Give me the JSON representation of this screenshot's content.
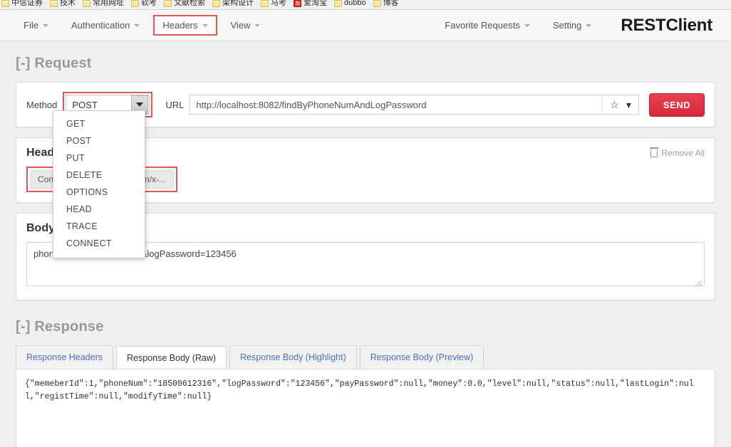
{
  "browser": {
    "bookmarks": [
      {
        "label": "中信证券",
        "icon": "folder-icon",
        "type": "folder"
      },
      {
        "label": "技术",
        "icon": "folder-icon",
        "type": "folder"
      },
      {
        "label": "常用网址",
        "icon": "folder-icon",
        "type": "folder"
      },
      {
        "label": "软考",
        "icon": "folder-icon",
        "type": "folder"
      },
      {
        "label": "文献检索",
        "icon": "folder-icon",
        "type": "folder"
      },
      {
        "label": "架构设计",
        "icon": "folder-icon",
        "type": "folder"
      },
      {
        "label": "马考",
        "icon": "folder-icon",
        "type": "folder"
      },
      {
        "label": "爱淘宝",
        "icon": "taobao-icon",
        "type": "site"
      },
      {
        "label": "dubbo",
        "icon": "folder-icon",
        "type": "folder"
      },
      {
        "label": "博客",
        "icon": "folder-icon",
        "type": "folder"
      }
    ]
  },
  "menubar": {
    "left_items": [
      {
        "label": "File",
        "name": "menu-file",
        "highlighted": false
      },
      {
        "label": "Authentication",
        "name": "menu-authentication",
        "highlighted": false
      },
      {
        "label": "Headers",
        "name": "menu-headers",
        "highlighted": true
      },
      {
        "label": "View",
        "name": "menu-view",
        "highlighted": false
      }
    ],
    "right_items": [
      {
        "label": "Favorite Requests",
        "name": "menu-favorite-requests"
      },
      {
        "label": "Setting",
        "name": "menu-setting"
      }
    ],
    "brand": "RESTClient"
  },
  "request": {
    "section_label": "[-] Request",
    "method_label": "Method",
    "method_value": "POST",
    "method_options": [
      "GET",
      "POST",
      "PUT",
      "DELETE",
      "OPTIONS",
      "HEAD",
      "TRACE",
      "CONNECT"
    ],
    "url_label": "URL",
    "url_value": "http://localhost:8082/findByPhoneNumAndLogPassword",
    "url_placeholder": "http://",
    "favorite_icon": "star-icon",
    "history_icon": "chevron-down-icon",
    "send_label": "SEND"
  },
  "headers": {
    "title": "Headers",
    "remove_all_label": "Remove All",
    "remove_all_icon": "trash-icon",
    "chip_label": "Content-Type",
    "chip_value": "application/x-..."
  },
  "body": {
    "title": "Body",
    "value": "phoneNum=18500612316&logPassword=123456"
  },
  "response": {
    "section_label": "[-] Response",
    "tabs": [
      {
        "label": "Response Headers",
        "active": false
      },
      {
        "label": "Response Body (Raw)",
        "active": true
      },
      {
        "label": "Response Body (Highlight)",
        "active": false
      },
      {
        "label": "Response Body (Preview)",
        "active": false
      }
    ],
    "body_text": "{\"memeberId\":1,\"phoneNum\":\"18500612316\",\"logPassword\":\"123456\",\"payPassword\":null,\"money\":0.0,\"level\":null,\"status\":null,\"lastLogin\":null,\"registTime\":null,\"modifyTime\":null}"
  },
  "colors": {
    "accent_red": "#e8544f",
    "send_red": "#d5293a",
    "link_blue": "#4c6fb5",
    "muted_gray": "#999999"
  }
}
